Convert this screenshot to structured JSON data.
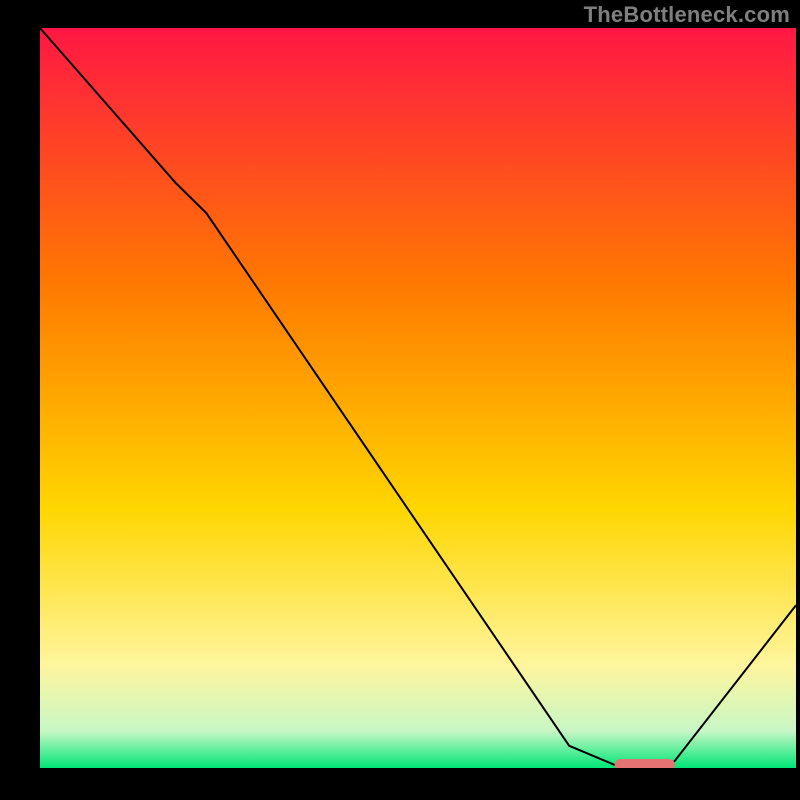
{
  "attribution": "TheBottleneck.com",
  "colors": {
    "background": "#000000",
    "attribution_text": "#7f7f7f",
    "gradient_top": "#ff1744",
    "gradient_mid_upper": "#ff7a00",
    "gradient_mid": "#ffd600",
    "gradient_lower": "#fff59d",
    "gradient_bottom": "#00e676",
    "curve": "#000000",
    "marker": "#e57373"
  },
  "chart_data": {
    "type": "line",
    "title": "",
    "xlabel": "",
    "ylabel": "",
    "xlim": [
      0,
      100
    ],
    "ylim": [
      0,
      100
    ],
    "series": [
      {
        "name": "bottleneck-curve",
        "x": [
          0,
          18,
          22,
          70,
          77,
          83,
          84,
          100
        ],
        "values": [
          100,
          79,
          75,
          3,
          0,
          0,
          1,
          22
        ]
      }
    ],
    "marker": {
      "name": "optimal-range",
      "x_start": 76,
      "x_end": 84,
      "y": 0
    },
    "gradient_stops_percent": [
      {
        "offset": 0,
        "value": 100
      },
      {
        "offset": 35,
        "value": 65
      },
      {
        "offset": 65,
        "value": 35
      },
      {
        "offset": 86,
        "value": 14
      },
      {
        "offset": 95,
        "value": 5
      },
      {
        "offset": 100,
        "value": 0
      }
    ]
  }
}
